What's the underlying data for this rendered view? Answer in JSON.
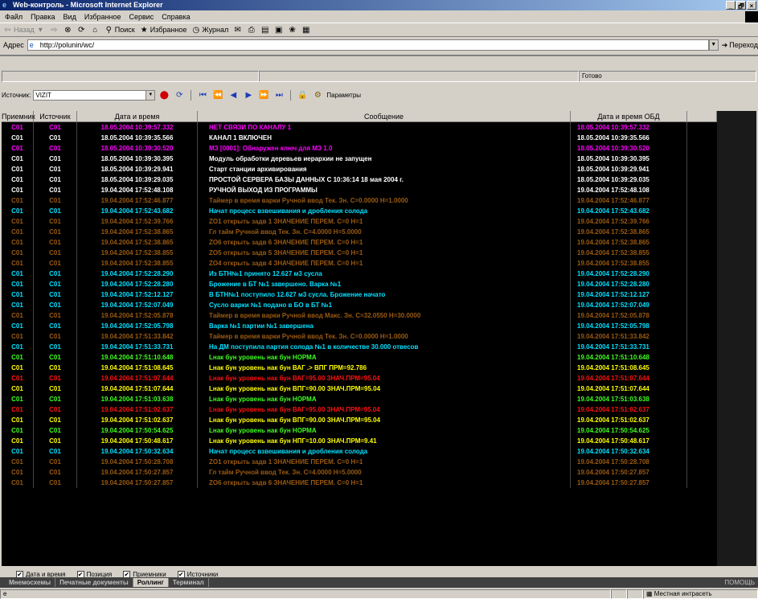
{
  "window": {
    "title": "Web-контроль - Microsoft Internet Explorer",
    "controls": [
      "_",
      "🗗",
      "×"
    ]
  },
  "menu": [
    "Файл",
    "Правка",
    "Вид",
    "Избранное",
    "Сервис",
    "Справка"
  ],
  "toolbar": {
    "back": "Назад",
    "search": "Поиск",
    "favorites": "Избранное",
    "journal": "Журнал"
  },
  "address": {
    "label": "Адрес",
    "url": "http://polunin/wc/",
    "go": "Переход"
  },
  "app_status": {
    "text": "Готово"
  },
  "source_bar": {
    "label": "Источник:",
    "value": "VIZIT",
    "params": "Параметры"
  },
  "columns": [
    "Приемник",
    "Источник",
    "Дата и время",
    "Сообщение",
    "Дата и время ОБД"
  ],
  "colors": {
    "magenta": "#ff00ff",
    "white": "#ffffff",
    "gray": "#9a5a10",
    "cyan": "#00e0ff",
    "green": "#40ff20",
    "yellow": "#ffff00",
    "red": "#ff1010"
  },
  "rows": [
    {
      "rx": "C01",
      "src": "C01",
      "dt": "18.05.2004  10:39:57.332",
      "msg": "НЕТ СВЯЗИ ПО КАНАЛУ 1",
      "obd": "18.05.2004  10:39:57.332",
      "c": "magenta"
    },
    {
      "rx": "C01",
      "src": "C01",
      "dt": "18.05.2004  10:39:35.566",
      "msg": "КАНАЛ 1 ВКЛЮЧЕН",
      "obd": "18.05.2004  10:39:35.566",
      "c": "white"
    },
    {
      "rx": "C01",
      "src": "C01",
      "dt": "18.05.2004  10:39:30.520",
      "msg": "МЗ [0001]: Обнаружен ключ для МЗ 1.0",
      "obd": "18.05.2004  10:39:30.520",
      "c": "magenta"
    },
    {
      "rx": "C01",
      "src": "C01",
      "dt": "18.05.2004  10:39:30.395",
      "msg": "Модуль обработки деревьев иерархии не запущен",
      "obd": "18.05.2004  10:39:30.395",
      "c": "white"
    },
    {
      "rx": "C01",
      "src": "C01",
      "dt": "18.05.2004  10:39:29.941",
      "msg": "Старт станции архивирования",
      "obd": "18.05.2004  10:39:29.941",
      "c": "white"
    },
    {
      "rx": "C01",
      "src": "C01",
      "dt": "18.05.2004  10:39:29.035",
      "msg": "ПРОСТОЙ СЕРВЕРА БАЗЫ ДАННЫХ С 10:36:14  18 мая 2004 г.",
      "obd": "18.05.2004  10:39:29.035",
      "c": "white"
    },
    {
      "rx": "C01",
      "src": "C01",
      "dt": "19.04.2004  17:52:48.108",
      "msg": "РУЧНОЙ ВЫХОД ИЗ ПРОГРАММЫ",
      "obd": "19.04.2004  17:52:48.108",
      "c": "white"
    },
    {
      "rx": "C01",
      "src": "C01",
      "dt": "19.04.2004  17:52:46.877",
      "msg": "Таймер в время   варки  Ручной ввод Тек. Зн.  С=0.0000 Н=1.0000",
      "obd": "19.04.2004  17:52:46.877",
      "c": "gray"
    },
    {
      "rx": "C01",
      "src": "C01",
      "dt": "19.04.2004  17:52:43.682",
      "msg": "Начат процесс взвешивания и дробления солода",
      "obd": "19.04.2004  17:52:43.682",
      "c": "cyan"
    },
    {
      "rx": "C01",
      "src": "C01",
      "dt": "19.04.2004  17:52:39.766",
      "msg": "ZO1 открыть задв 1 ЗНАЧЕНИЕ ПЕРЕМ.  С=0  Н=1",
      "obd": "19.04.2004  17:52:39.766",
      "c": "gray"
    },
    {
      "rx": "C01",
      "src": "C01",
      "dt": "19.04.2004  17:52:38.865",
      "msg": "Гл тайм             Ручной ввод Тек. Зн.  С=4.0000 Н=5.0000",
      "obd": "19.04.2004  17:52:38.865",
      "c": "gray"
    },
    {
      "rx": "C01",
      "src": "C01",
      "dt": "19.04.2004  17:52:38.865",
      "msg": "ZO6 открыть задв 6 ЗНАЧЕНИЕ ПЕРЕМ.  С=0  Н=1",
      "obd": "19.04.2004  17:52:38.865",
      "c": "gray"
    },
    {
      "rx": "C01",
      "src": "C01",
      "dt": "19.04.2004  17:52:38.855",
      "msg": "ZO5 открыть задв 5 ЗНАЧЕНИЕ ПЕРЕМ.  С=0  Н=1",
      "obd": "19.04.2004  17:52:38.855",
      "c": "gray"
    },
    {
      "rx": "C01",
      "src": "C01",
      "dt": "19.04.2004  17:52:38.855",
      "msg": "ZO4 открыть задв 4 ЗНАЧЕНИЕ ПЕРЕМ.  С=0  Н=1",
      "obd": "19.04.2004  17:52:38.855",
      "c": "gray"
    },
    {
      "rx": "C01",
      "src": "C01",
      "dt": "19.04.2004  17:52:28.290",
      "msg": "Из БТН№1 принято  12.627 м3 сусла",
      "obd": "19.04.2004  17:52:28.290",
      "c": "cyan"
    },
    {
      "rx": "C01",
      "src": "C01",
      "dt": "19.04.2004  17:52:28.280",
      "msg": "Брожение в БТ №1 завершено. Варка №1",
      "obd": "19.04.2004  17:52:28.280",
      "c": "cyan"
    },
    {
      "rx": "C01",
      "src": "C01",
      "dt": "19.04.2004  17:52:12.127",
      "msg": "В БТН№1 поступило  12.627 м3 сусла. Брожение начато",
      "obd": "19.04.2004  17:52:12.127",
      "c": "cyan"
    },
    {
      "rx": "C01",
      "src": "C01",
      "dt": "19.04.2004  17:52:07.049",
      "msg": "Сусло варки №1 подано в БО в БТ №1",
      "obd": "19.04.2004  17:52:07.049",
      "c": "cyan"
    },
    {
      "rx": "C01",
      "src": "C01",
      "dt": "19.04.2004  17:52:05.878",
      "msg": "Таймер в время   варки  Ручной ввод Макс. Зн.  С=32.0550 Н=30.0000",
      "obd": "19.04.2004  17:52:05.878",
      "c": "gray"
    },
    {
      "rx": "C01",
      "src": "C01",
      "dt": "19.04.2004  17:52:05.798",
      "msg": "Варка №1 партии №1 завершена",
      "obd": "19.04.2004  17:52:05.798",
      "c": "cyan"
    },
    {
      "rx": "C01",
      "src": "C01",
      "dt": "19.04.2004  17:51:33.842",
      "msg": "Таймер в время   варки  Ручной ввод Тек. Зн.  С=0.0000 Н=1.0000",
      "obd": "19.04.2004  17:51:33.842",
      "c": "gray"
    },
    {
      "rx": "C01",
      "src": "C01",
      "dt": "19.04.2004  17:51:33.731",
      "msg": "На ДМ поступила партия солода №1 в количестве  30.000 отвесов",
      "obd": "19.04.2004  17:51:33.731",
      "c": "cyan"
    },
    {
      "rx": "C01",
      "src": "C01",
      "dt": "19.04.2004  17:51:10.648",
      "msg": "Lнак бун уровень нак бун НОРМА",
      "obd": "19.04.2004  17:51:10.648",
      "c": "green"
    },
    {
      "rx": "C01",
      "src": "C01",
      "dt": "19.04.2004  17:51:08.645",
      "msg": "Lнак бун уровень нак бун ВАГ .> ВПГ  ПРМ=92.786",
      "obd": "19.04.2004  17:51:08.645",
      "c": "yellow"
    },
    {
      "rx": "C01",
      "src": "C01",
      "dt": "19.04.2004  17:51:07.644",
      "msg": "Lнак бун уровень нак бун ВАГ=95.00 ЗНАЧ.ПРМ=95.04",
      "obd": "19.04.2004  17:51:07.644",
      "c": "red"
    },
    {
      "rx": "C01",
      "src": "C01",
      "dt": "19.04.2004  17:51:07.644",
      "msg": "Lнак бун уровень нак бун ВПГ=90.00 ЗНАЧ.ПРМ=95.04",
      "obd": "19.04.2004  17:51:07.644",
      "c": "yellow"
    },
    {
      "rx": "C01",
      "src": "C01",
      "dt": "19.04.2004  17:51:03.638",
      "msg": "Lнак бун уровень нак бун НОРМА",
      "obd": "19.04.2004  17:51:03.638",
      "c": "green"
    },
    {
      "rx": "C01",
      "src": "C01",
      "dt": "19.04.2004  17:51:02.637",
      "msg": "Lнак бун уровень нак бун ВАГ=95.00 ЗНАЧ.ПРМ=95.04",
      "obd": "19.04.2004  17:51:02.637",
      "c": "red"
    },
    {
      "rx": "C01",
      "src": "C01",
      "dt": "19.04.2004  17:51:02.637",
      "msg": "Lнак бун уровень нак бун ВПГ=90.00 ЗНАЧ.ПРМ=95.04",
      "obd": "19.04.2004  17:51:02.637",
      "c": "yellow"
    },
    {
      "rx": "C01",
      "src": "C01",
      "dt": "19.04.2004  17:50:54.625",
      "msg": "Lнак бун уровень нак бун НОРМА",
      "obd": "19.04.2004  17:50:54.625",
      "c": "green"
    },
    {
      "rx": "C01",
      "src": "C01",
      "dt": "19.04.2004  17:50:48.617",
      "msg": "Lнак бун уровень нак бун НПГ=10.00 ЗНАЧ.ПРМ=9.41",
      "obd": "19.04.2004  17:50:48.617",
      "c": "yellow"
    },
    {
      "rx": "C01",
      "src": "C01",
      "dt": "19.04.2004  17:50:32.634",
      "msg": "Начат процесс взвешивания и дробления солода",
      "obd": "19.04.2004  17:50:32.634",
      "c": "cyan"
    },
    {
      "rx": "C01",
      "src": "C01",
      "dt": "19.04.2004  17:50:28.708",
      "msg": "ZO1 открыть задв 1 ЗНАЧЕНИЕ ПЕРЕМ.  С=0  Н=1",
      "obd": "19.04.2004  17:50:28.708",
      "c": "gray"
    },
    {
      "rx": "C01",
      "src": "C01",
      "dt": "19.04.2004  17:50:27.857",
      "msg": "Гл тайм             Ручной ввод Тек. Зн.  С=4.0000 Н=5.0000",
      "obd": "19.04.2004  17:50:27.857",
      "c": "gray"
    },
    {
      "rx": "C01",
      "src": "C01",
      "dt": "19.04.2004  17:50:27.857",
      "msg": "ZO6 открыть задв 6 ЗНАЧЕНИЕ ПЕРЕМ.  С=0  Н=1",
      "obd": "19.04.2004  17:50:27.857",
      "c": "gray"
    }
  ],
  "checkboxes": [
    "Дата и время",
    "Позиция",
    "Приемники",
    "Источники"
  ],
  "tabs": [
    "Мнемосхемы",
    "Печатные документы",
    "Роллинг",
    "Терминал"
  ],
  "active_tab": "Роллинг",
  "help": "ПОМОЩЬ",
  "ie_status": {
    "zone": "Местная интрасеть"
  }
}
